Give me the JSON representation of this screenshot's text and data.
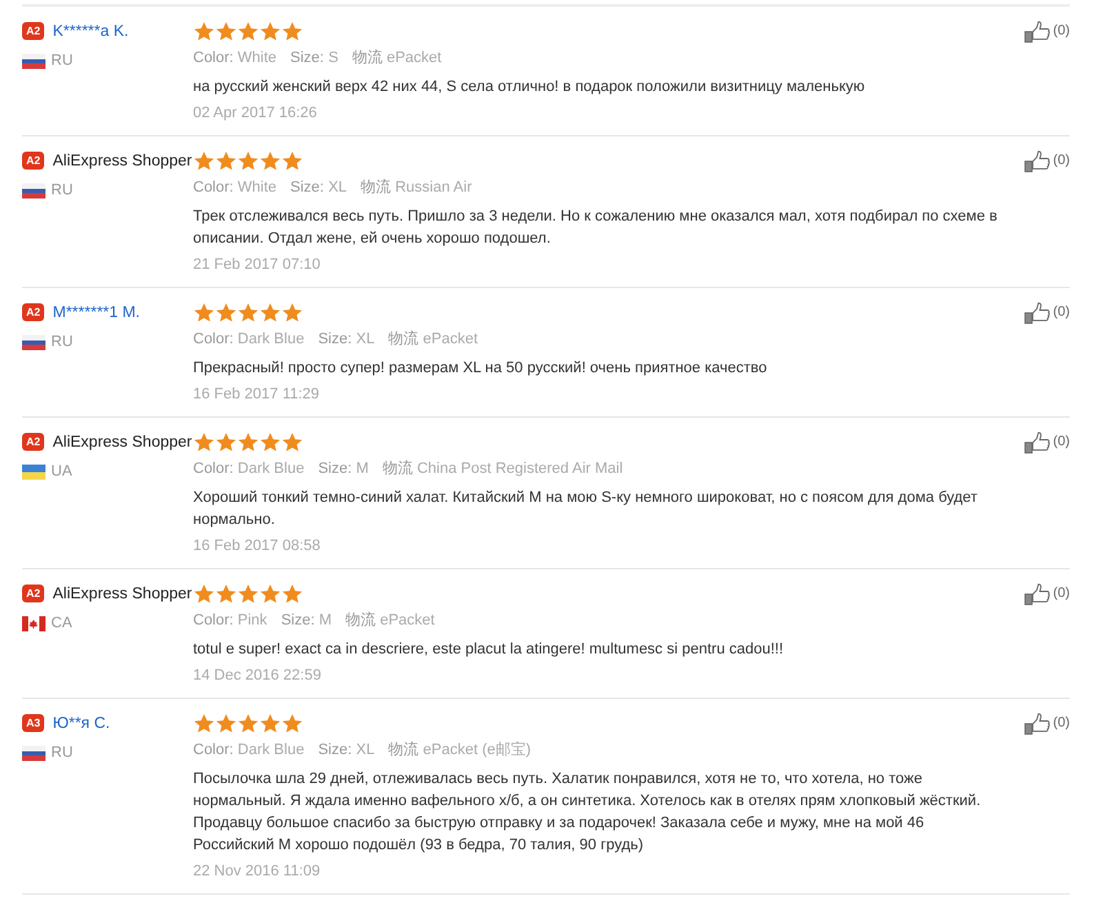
{
  "reviews": [
    {
      "badge": "A2",
      "name": "K******a K.",
      "linked": true,
      "country": "RU",
      "stars": 5,
      "color_label": "Color:",
      "color_value": "White",
      "size_label": "Size:",
      "size": "S",
      "shipping_label": "物流",
      "shipping": "ePacket",
      "text": "на русский женский верх 42 них 44, S села отлично! в подарок положили визитницу маленькую",
      "date": "02 Apr 2017 16:26",
      "likes": "(0)"
    },
    {
      "badge": "A2",
      "name": "AliExpress Shopper",
      "linked": false,
      "country": "RU",
      "stars": 5,
      "color_label": "Color:",
      "color_value": "White",
      "size_label": "Size:",
      "size": "XL",
      "shipping_label": "物流",
      "shipping": "Russian Air",
      "text": "Трек отслеживался весь путь. Пришло за 3 недели. Но к сожалению мне оказался мал, хотя подбирал по схеме в описании. Отдал жене, ей очень хорошо подошел.",
      "date": "21 Feb 2017 07:10",
      "likes": "(0)"
    },
    {
      "badge": "A2",
      "name": "M*******1 M.",
      "linked": true,
      "country": "RU",
      "stars": 5,
      "color_label": "Color:",
      "color_value": "Dark Blue",
      "size_label": "Size:",
      "size": "XL",
      "shipping_label": "物流",
      "shipping": "ePacket",
      "text": "Прекрасный! просто супер! размерам XL на 50 русский! очень приятное качество",
      "date": "16 Feb 2017 11:29",
      "likes": "(0)"
    },
    {
      "badge": "A2",
      "name": "AliExpress Shopper",
      "linked": false,
      "country": "UA",
      "stars": 5,
      "color_label": "Color:",
      "color_value": "Dark Blue",
      "size_label": "Size:",
      "size": "M",
      "shipping_label": "物流",
      "shipping": "China Post Registered Air Mail",
      "text": "Хороший тонкий темно-синий халат. Китайский M на мою S-ку немного широковат, но с поясом для дома будет нормально.",
      "date": "16 Feb 2017 08:58",
      "likes": "(0)"
    },
    {
      "badge": "A2",
      "name": "AliExpress Shopper",
      "linked": false,
      "country": "CA",
      "stars": 5,
      "color_label": "Color:",
      "color_value": "Pink",
      "size_label": "Size:",
      "size": "M",
      "shipping_label": "物流",
      "shipping": "ePacket",
      "text": "totul e super! exact ca in descriere, este placut la atingere! multumesc si pentru cadou!!!",
      "date": "14 Dec 2016 22:59",
      "likes": "(0)"
    },
    {
      "badge": "A3",
      "name": "Ю**я С.",
      "linked": true,
      "country": "RU",
      "stars": 5,
      "color_label": "Color:",
      "color_value": "Dark Blue",
      "size_label": "Size:",
      "size": "XL",
      "shipping_label": "物流",
      "shipping": "ePacket (e邮宝)",
      "text": "Посылочка шла 29 дней, отлеживалась весь путь. Халатик понравился, хотя не то, что хотела, но тоже нормальный. Я ждала именно вафельного х/б, а он синтетика. Хотелось как в отелях прям хлопковый жёсткий. Продавцу большое спасибо за быструю отправку и за подарочек! Заказала себе и мужу, мне на мой 46 Российский M хорошо подошёл (93 в бедра, 70 талия, 90 грудь)",
      "date": "22 Nov 2016 11:09",
      "likes": "(0)"
    }
  ]
}
